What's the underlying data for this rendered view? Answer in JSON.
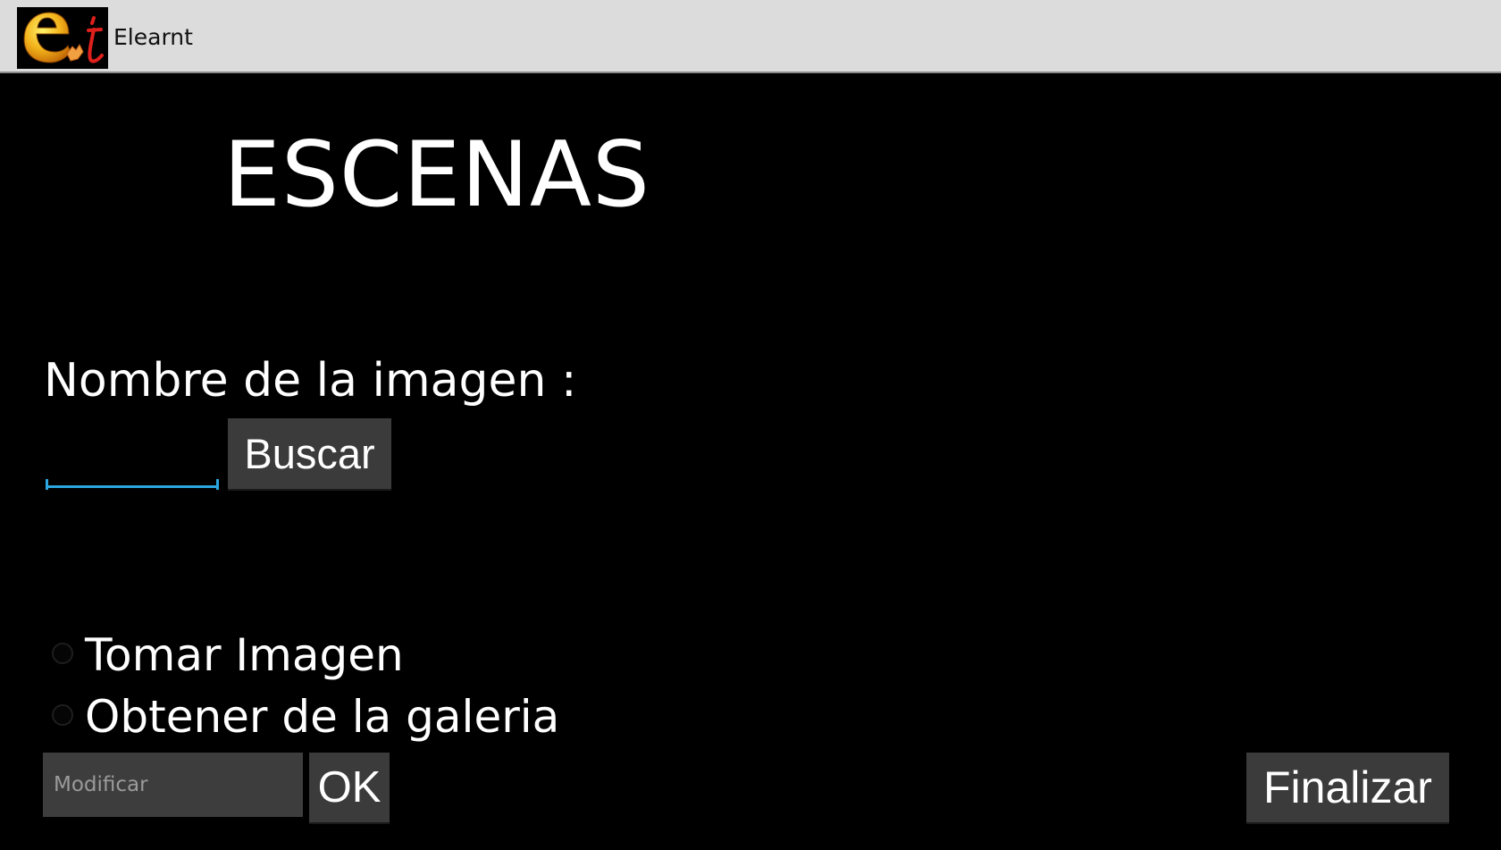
{
  "app": {
    "title": "Elearnt",
    "logo_icon": "elearnt-logo-icon",
    "accent_color": "#2ba6de"
  },
  "screen": {
    "heading": "ESCENAS",
    "image_name_label": "Nombre de la imagen :",
    "image_name_value": "",
    "search_button": "Buscar",
    "radio_options": [
      {
        "label": "Tomar Imagen",
        "checked": false
      },
      {
        "label": "Obtener de la galeria",
        "checked": false
      }
    ],
    "modify_placeholder": "Modificar",
    "ok_button": "OK",
    "finish_button": "Finalizar"
  }
}
